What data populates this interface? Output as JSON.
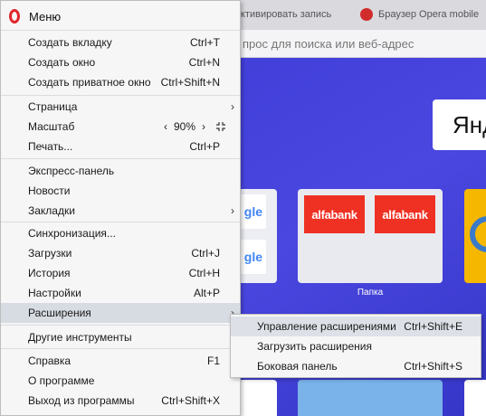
{
  "background": {
    "tabs": [
      "ктивировать запись",
      "Браузер Opera mobile"
    ],
    "address_placeholder": "прос для поиска или веб-адрес",
    "yandex": "Янд",
    "google": "gle",
    "alfa_label": "alfabank",
    "folder_label": "Папка"
  },
  "menu": {
    "title": "Меню",
    "items": {
      "new_tab": {
        "label": "Создать вкладку",
        "shortcut": "Ctrl+T"
      },
      "new_window": {
        "label": "Создать окно",
        "shortcut": "Ctrl+N"
      },
      "new_private": {
        "label": "Создать приватное окно",
        "shortcut": "Ctrl+Shift+N"
      },
      "page": {
        "label": "Страница"
      },
      "zoom": {
        "label": "Масштаб",
        "prev": "‹",
        "value": "90%",
        "next": "›"
      },
      "print": {
        "label": "Печать...",
        "shortcut": "Ctrl+P"
      },
      "speed_dial": {
        "label": "Экспресс-панель"
      },
      "news": {
        "label": "Новости"
      },
      "bookmarks": {
        "label": "Закладки"
      },
      "sync": {
        "label": "Синхронизация..."
      },
      "downloads": {
        "label": "Загрузки",
        "shortcut": "Ctrl+J"
      },
      "history": {
        "label": "История",
        "shortcut": "Ctrl+H"
      },
      "settings": {
        "label": "Настройки",
        "shortcut": "Alt+P"
      },
      "extensions": {
        "label": "Расширения"
      },
      "other_tools": {
        "label": "Другие инструменты"
      },
      "help": {
        "label": "Справка",
        "shortcut": "F1"
      },
      "about": {
        "label": "О программе"
      },
      "exit": {
        "label": "Выход из программы",
        "shortcut": "Ctrl+Shift+X"
      }
    },
    "arrow": "›"
  },
  "submenu": {
    "manage": {
      "label": "Управление расширениями",
      "shortcut": "Ctrl+Shift+E"
    },
    "get": {
      "label": "Загрузить расширения"
    },
    "sidebar": {
      "label": "Боковая панель",
      "shortcut": "Ctrl+Shift+S"
    }
  },
  "colors": {
    "accent": "#e0262b",
    "speed_dial_bg": "#3d3ad6",
    "highlight": "#d7dbe2"
  }
}
